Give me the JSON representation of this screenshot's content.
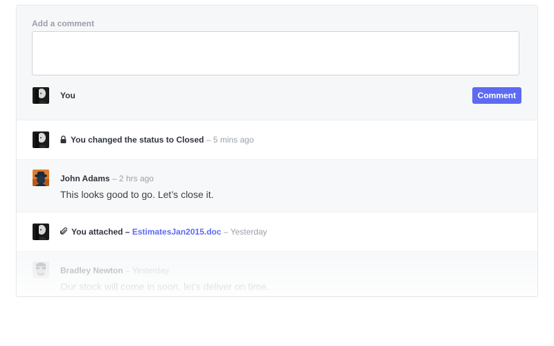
{
  "composer": {
    "label": "Add a comment",
    "placeholder": "",
    "user_name": "You",
    "submit_label": "Comment"
  },
  "feed": {
    "status_event": {
      "text": "You changed the status to Closed",
      "time": "– 5 mins ago",
      "icon": "lock-icon"
    },
    "comment_1": {
      "author": "John Adams",
      "time": "– 2 hrs ago",
      "body": "This looks good to go. Let’s close it."
    },
    "attachment_event": {
      "prefix": "You attached –",
      "file_name": "EstimatesJan2015.doc",
      "time": "– Yesterday",
      "icon": "paperclip-icon"
    },
    "comment_2": {
      "author": "Bradley Newton",
      "time": "– Yesterday",
      "body": "Our stock will come in soon, let’s deliver on time."
    }
  },
  "colors": {
    "accent": "#5c6bf2",
    "text": "#2f343b",
    "muted": "#9aa0a8"
  }
}
